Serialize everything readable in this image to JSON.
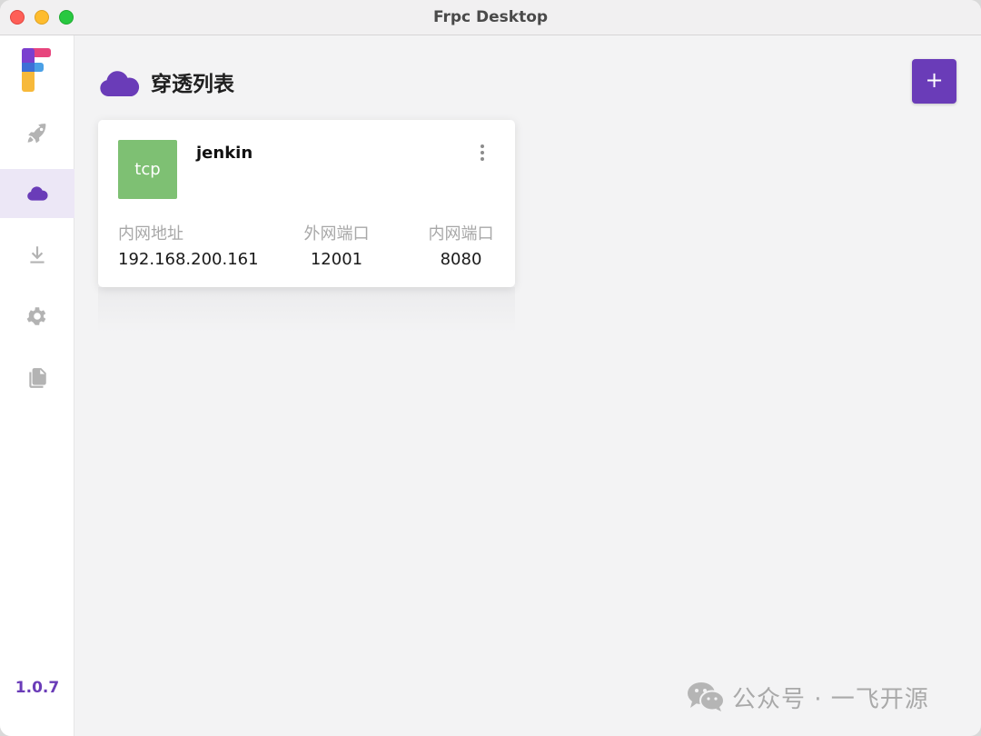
{
  "window": {
    "title": "Frpc Desktop"
  },
  "sidebar": {
    "items": [
      {
        "name": "rocket-icon",
        "active": false
      },
      {
        "name": "cloud-icon",
        "active": true
      },
      {
        "name": "download-icon",
        "active": false
      },
      {
        "name": "gear-icon",
        "active": false
      },
      {
        "name": "file-copy-icon",
        "active": false
      }
    ],
    "version": "1.0.7"
  },
  "header": {
    "title": "穿透列表",
    "add_label": "+"
  },
  "proxies": [
    {
      "type": "tcp",
      "name": "jenkin",
      "labels": {
        "local_ip": "内网地址",
        "remote_port": "外网端口",
        "local_port": "内网端口"
      },
      "local_ip": "192.168.200.161",
      "remote_port": "12001",
      "local_port": "8080"
    }
  ],
  "watermark": {
    "text": "公众号 · 一飞开源"
  },
  "colors": {
    "accent": "#6a3cb8",
    "badge_tcp": "#7ec073",
    "active_nav_bg": "#ece7f6",
    "icon_gray": "#b3b3b3"
  }
}
